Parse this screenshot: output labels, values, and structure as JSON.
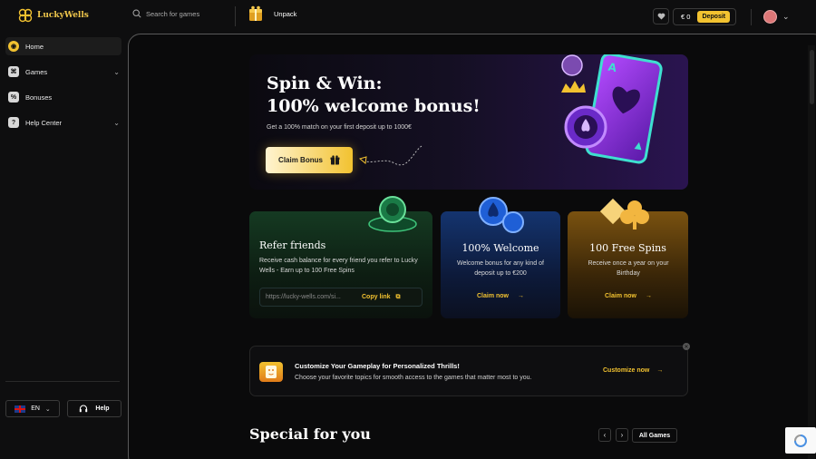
{
  "brand": {
    "name": "LuckyWells",
    "accent": "#f2c230"
  },
  "header": {
    "search_placeholder": "Search for games",
    "unpack_label": "Unpack",
    "balance": "€ 0",
    "deposit_label": "Deposit"
  },
  "sidebar": {
    "items": [
      {
        "label": "Home",
        "icon": "home-icon",
        "active": true
      },
      {
        "label": "Games",
        "icon": "games-icon",
        "expandable": true
      },
      {
        "label": "Bonuses",
        "icon": "bonuses-icon"
      },
      {
        "label": "Help Center",
        "icon": "help-icon",
        "expandable": true
      }
    ],
    "language": "EN",
    "help_label": "Help"
  },
  "hero": {
    "title_line1": "Spin & Win:",
    "title_line2": "100% welcome bonus!",
    "subtitle": "Get a 100% match on your first deposit up to 1000€",
    "cta": "Claim Bonus"
  },
  "cards": {
    "refer": {
      "title": "Refer friends",
      "desc": "Receive cash balance for every friend you refer to Lucky Wells - Earn up to 100 Free Spins",
      "link_value": "https://lucky-wells.com/si...",
      "copy_label": "Copy link"
    },
    "welcome": {
      "title": "100% Welcome",
      "desc": "Welcome bonus for any kind of deposit up to €200",
      "cta": "Claim now"
    },
    "spins": {
      "title": "100 Free Spins",
      "desc": "Receive once a year on your Birthday",
      "cta": "Claim now"
    }
  },
  "customize": {
    "title": "Customize Your Gameplay for Personalized Thrills!",
    "desc": "Choose your favorite topics for smooth access to the games that matter most to you.",
    "cta": "Customize now"
  },
  "special": {
    "title": "Special for you",
    "all_games": "All Games"
  }
}
